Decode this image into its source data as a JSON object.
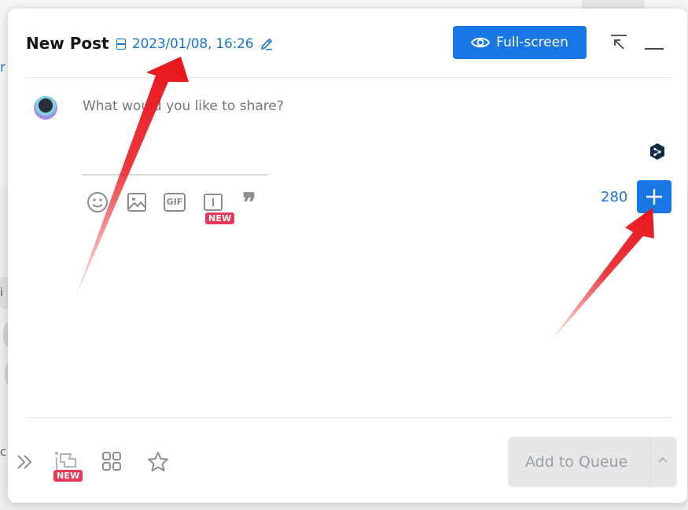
{
  "background": {
    "link_fragment": "r",
    "chip_fragment": "i",
    "text_fragment": "c"
  },
  "dialog": {
    "title": "New Post",
    "schedule_date": "2023/01/08, 16:26",
    "fullscreen_label": "Full-screen",
    "composer_placeholder": "What would you like to share?",
    "char_count": "280",
    "toolbar": {
      "emoji_icon": "emoji-icon",
      "image_icon": "image-icon",
      "gif_label": "GIF",
      "poll_badge": "NEW",
      "quote_glyph": "❞"
    },
    "footer": {
      "flag_badge": "NEW",
      "queue_label": "Add to Queue"
    }
  },
  "colors": {
    "accent": "#1877e5",
    "badge": "#e6395a",
    "annotation": "#e8161c"
  }
}
